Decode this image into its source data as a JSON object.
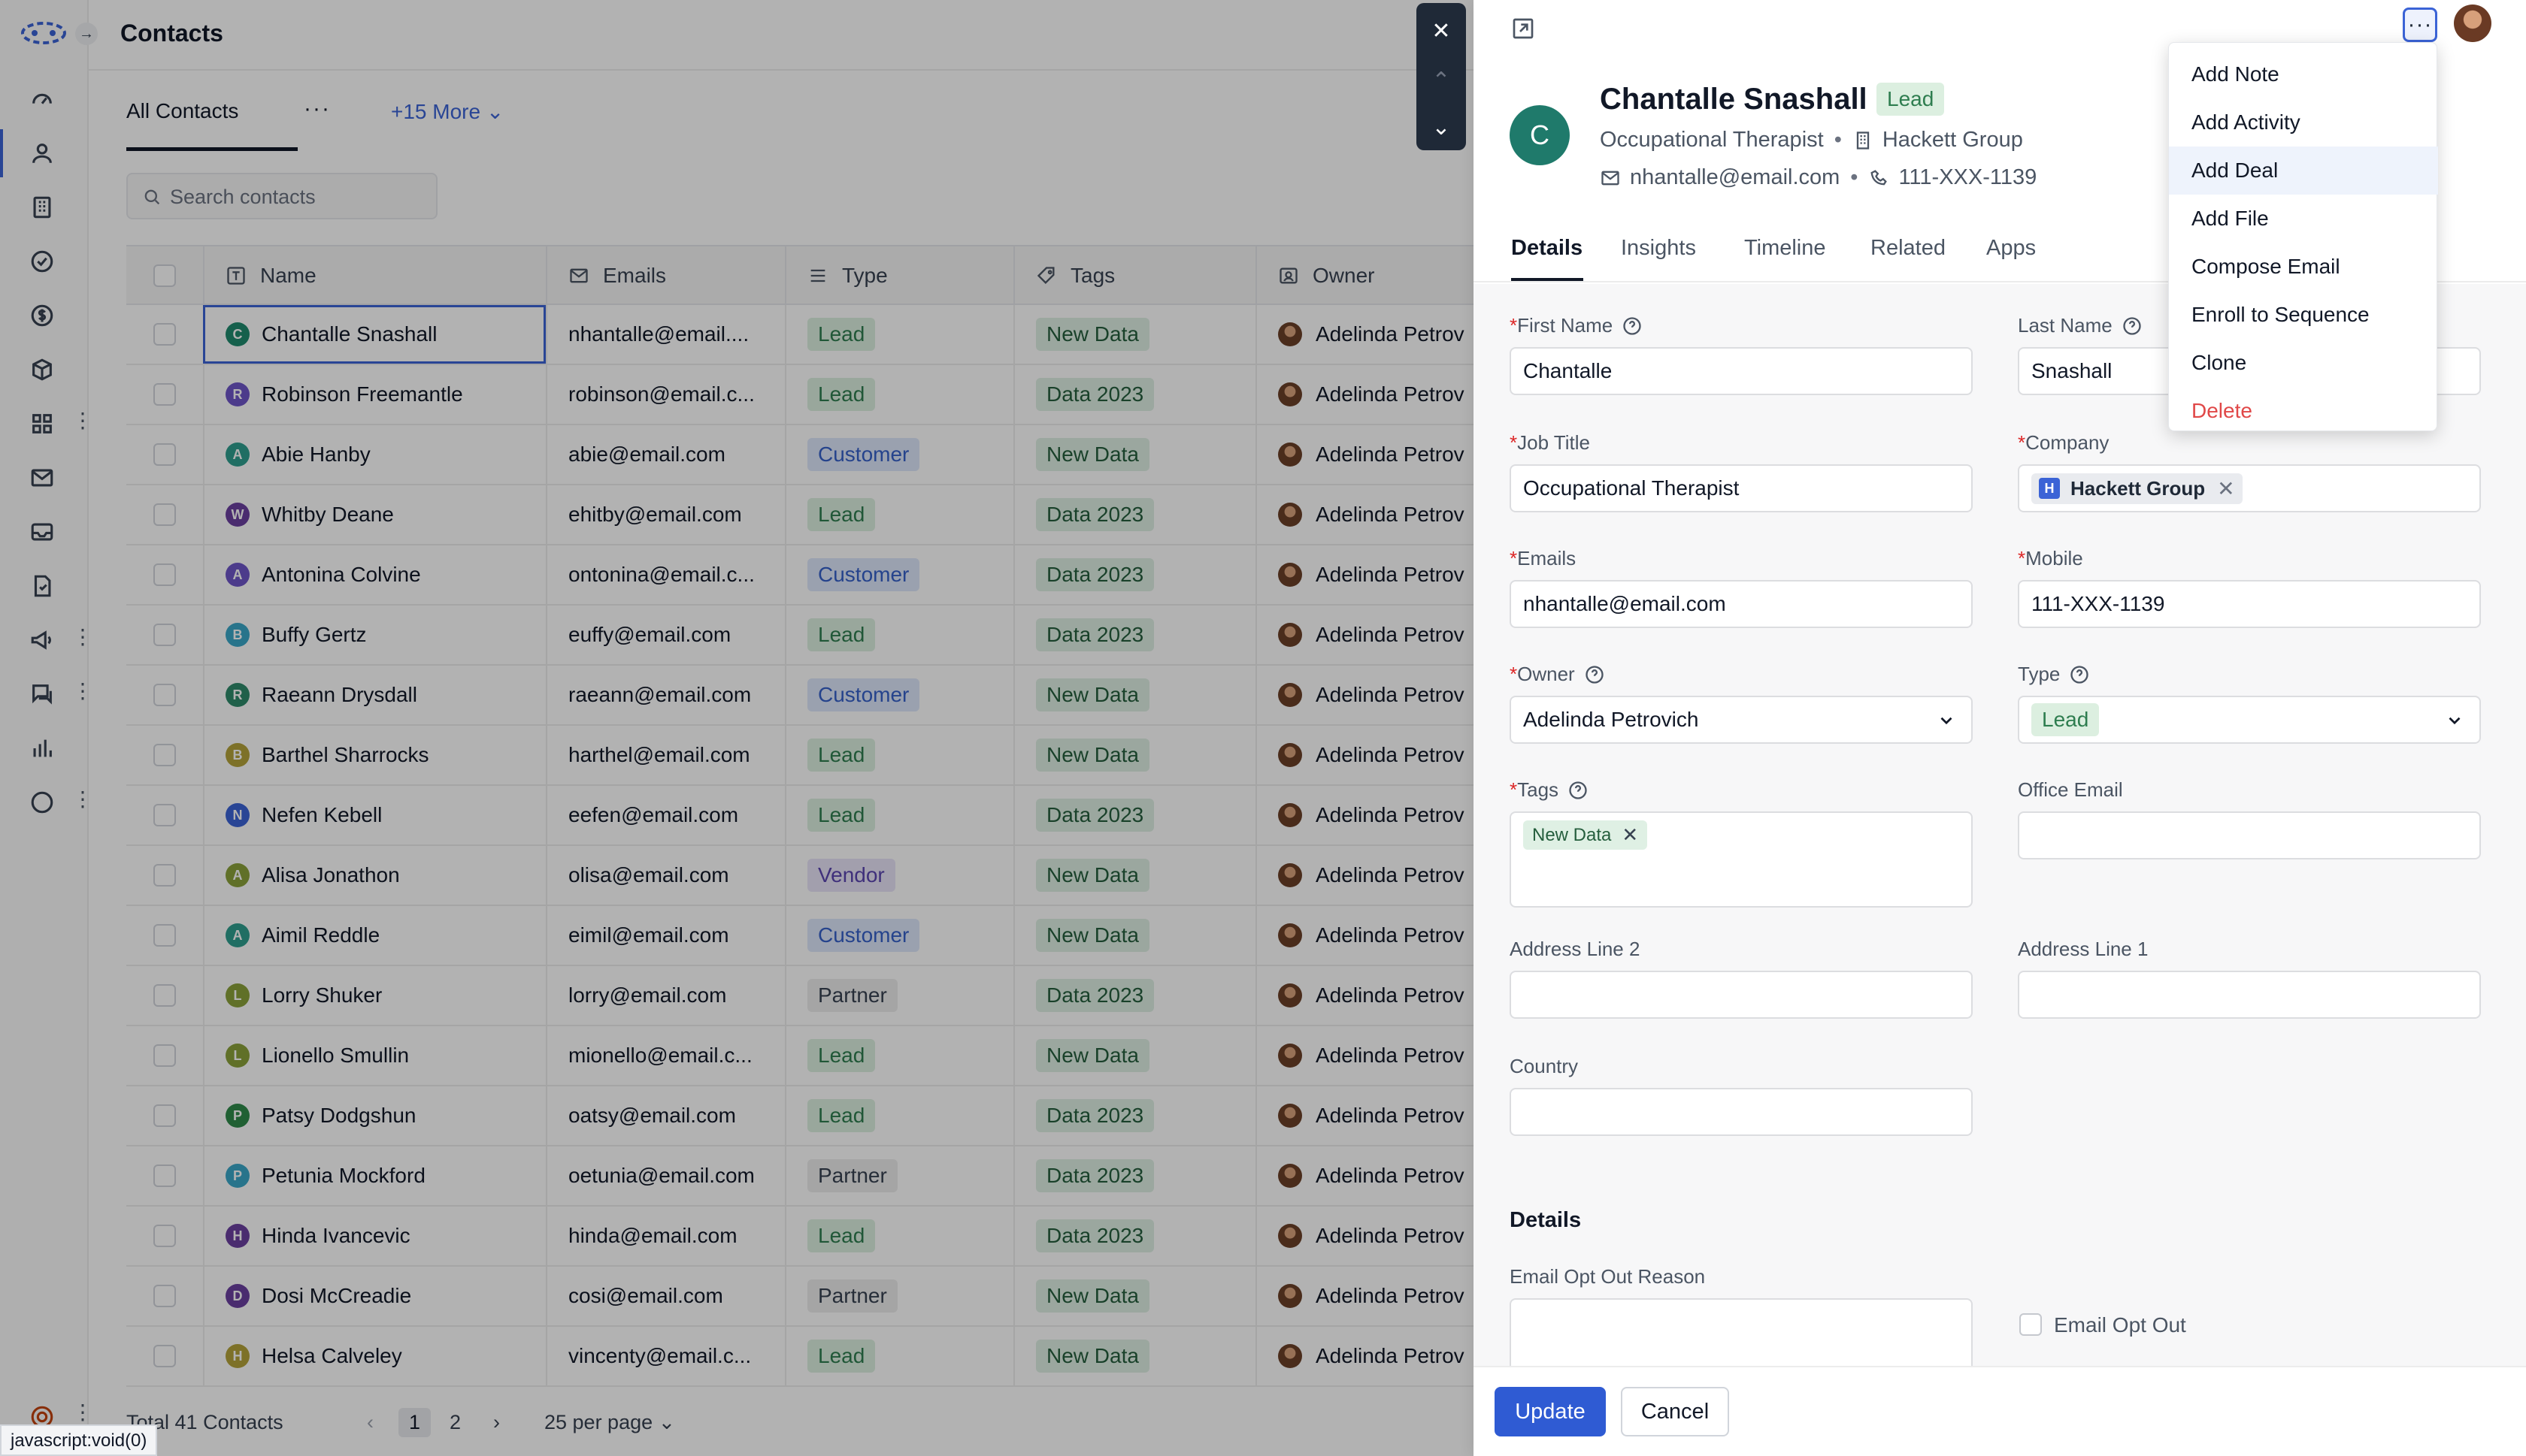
{
  "app": {
    "page_title": "Contacts"
  },
  "views": {
    "active": "All Contacts",
    "more": "+15 More"
  },
  "search": {
    "placeholder": "Search contacts"
  },
  "table": {
    "columns": [
      "Name",
      "Emails",
      "Type",
      "Tags",
      "Owner"
    ],
    "rows": [
      {
        "initial": "C",
        "color": "#1f8a6e",
        "name": "Chantalle Snashall",
        "email": "nhantalle@email....",
        "type": "Lead",
        "tag": "New Data",
        "owner": "Adelinda Petrov"
      },
      {
        "initial": "R",
        "color": "#6d55c8",
        "name": "Robinson Freemantle",
        "email": "robinson@email.c...",
        "type": "Lead",
        "tag": "Data 2023",
        "owner": "Adelinda Petrov"
      },
      {
        "initial": "A",
        "color": "#2f9e8f",
        "name": "Abie Hanby",
        "email": "abie@email.com",
        "type": "Customer",
        "tag": "New Data",
        "owner": "Adelinda Petrov"
      },
      {
        "initial": "W",
        "color": "#6b3fa0",
        "name": "Whitby Deane",
        "email": "ehitby@email.com",
        "type": "Lead",
        "tag": "Data 2023",
        "owner": "Adelinda Petrov"
      },
      {
        "initial": "A",
        "color": "#6d55c8",
        "name": "Antonina Colvine",
        "email": "ontonina@email.c...",
        "type": "Customer",
        "tag": "Data 2023",
        "owner": "Adelinda Petrov"
      },
      {
        "initial": "B",
        "color": "#3aa6c8",
        "name": "Buffy Gertz",
        "email": "euffy@email.com",
        "type": "Lead",
        "tag": "Data 2023",
        "owner": "Adelinda Petrov"
      },
      {
        "initial": "R",
        "color": "#2f8a6a",
        "name": "Raeann Drysdall",
        "email": "raeann@email.com",
        "type": "Customer",
        "tag": "New Data",
        "owner": "Adelinda Petrov"
      },
      {
        "initial": "B",
        "color": "#b3a33a",
        "name": "Barthel Sharrocks",
        "email": "harthel@email.com",
        "type": "Lead",
        "tag": "New Data",
        "owner": "Adelinda Petrov"
      },
      {
        "initial": "N",
        "color": "#3b63d6",
        "name": "Nefen Kebell",
        "email": "eefen@email.com",
        "type": "Lead",
        "tag": "Data 2023",
        "owner": "Adelinda Petrov"
      },
      {
        "initial": "A",
        "color": "#8aa13a",
        "name": "Alisa Jonathon",
        "email": "olisa@email.com",
        "type": "Vendor",
        "tag": "New Data",
        "owner": "Adelinda Petrov"
      },
      {
        "initial": "A",
        "color": "#2f9e8f",
        "name": "Aimil Reddle",
        "email": "eimil@email.com",
        "type": "Customer",
        "tag": "New Data",
        "owner": "Adelinda Petrov"
      },
      {
        "initial": "L",
        "color": "#8aa13a",
        "name": "Lorry Shuker",
        "email": "lorry@email.com",
        "type": "Partner",
        "tag": "Data 2023",
        "owner": "Adelinda Petrov"
      },
      {
        "initial": "L",
        "color": "#8aa13a",
        "name": "Lionello Smullin",
        "email": "mionello@email.c...",
        "type": "Lead",
        "tag": "New Data",
        "owner": "Adelinda Petrov"
      },
      {
        "initial": "P",
        "color": "#2f8a4a",
        "name": "Patsy Dodgshun",
        "email": "oatsy@email.com",
        "type": "Lead",
        "tag": "Data 2023",
        "owner": "Adelinda Petrov"
      },
      {
        "initial": "P",
        "color": "#3aa6c8",
        "name": "Petunia Mockford",
        "email": "oetunia@email.com",
        "type": "Partner",
        "tag": "Data 2023",
        "owner": "Adelinda Petrov"
      },
      {
        "initial": "H",
        "color": "#6b3fa0",
        "name": "Hinda Ivancevic",
        "email": "hinda@email.com",
        "type": "Lead",
        "tag": "Data 2023",
        "owner": "Adelinda Petrov"
      },
      {
        "initial": "D",
        "color": "#6b3fa0",
        "name": "Dosi McCreadie",
        "email": "cosi@email.com",
        "type": "Partner",
        "tag": "New Data",
        "owner": "Adelinda Petrov"
      },
      {
        "initial": "H",
        "color": "#b3a33a",
        "name": "Helsa Calveley",
        "email": "vincenty@email.c...",
        "type": "Lead",
        "tag": "New Data",
        "owner": "Adelinda Petrov"
      }
    ]
  },
  "footer": {
    "total": "Total 41 Contacts",
    "page1": "1",
    "page2": "2",
    "per_page": "25 per page"
  },
  "status_bar": "javascript:void(0)",
  "panel": {
    "name": "Chantalle Snashall",
    "badge": "Lead",
    "avatar_initial": "C",
    "job_title": "Occupational Therapist",
    "company": "Hackett Group",
    "email": "nhantalle@email.com",
    "phone": "111-XXX-1139",
    "tabs": [
      "Details",
      "Insights",
      "Timeline",
      "Related",
      "Apps"
    ],
    "fields": {
      "first_name_label": "First Name",
      "first_name": "Chantalle",
      "last_name_label": "Last Name",
      "last_name": "Snashall",
      "job_title_label": "Job Title",
      "job_title": "Occupational Therapist",
      "company_label": "Company",
      "company_initial": "H",
      "company": "Hackett Group",
      "emails_label": "Emails",
      "emails": "nhantalle@email.com",
      "mobile_label": "Mobile",
      "mobile": "111-XXX-1139",
      "owner_label": "Owner",
      "owner": "Adelinda Petrovich",
      "type_label": "Type",
      "type": "Lead",
      "tags_label": "Tags",
      "tag": "New Data",
      "office_email_label": "Office Email",
      "address2_label": "Address Line 2",
      "address1_label": "Address Line 1",
      "country_label": "Country",
      "details_section": "Details",
      "opt_out_reason_label": "Email Opt Out Reason",
      "opt_out_label": "Email Opt Out"
    },
    "update_label": "Update",
    "cancel_label": "Cancel"
  },
  "menu": {
    "items": [
      "Add Note",
      "Add Activity",
      "Add Deal",
      "Add File",
      "Compose Email",
      "Enroll to Sequence",
      "Clone",
      "Delete"
    ],
    "hovered": "Add Deal"
  },
  "colors": {
    "accent": "#3b63d6",
    "danger": "#e04848",
    "lead_bg": "#dcefe0"
  }
}
